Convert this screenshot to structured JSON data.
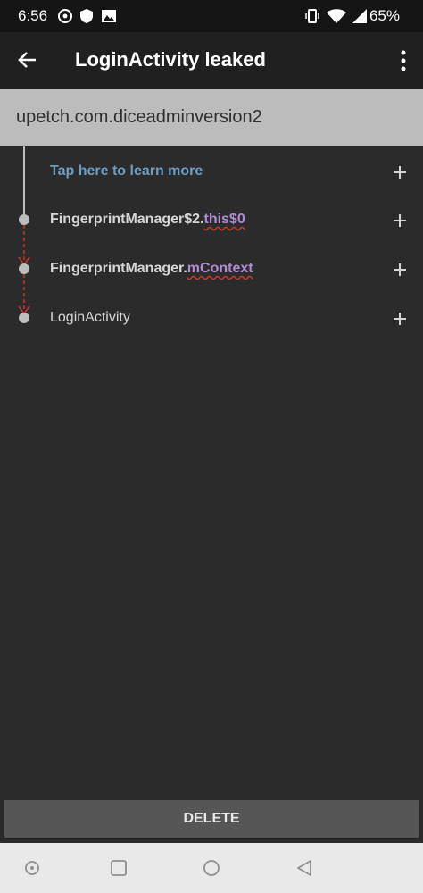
{
  "status": {
    "time": "6:56",
    "battery": "65%"
  },
  "toolbar": {
    "title": "LoginActivity leaked"
  },
  "header": {
    "package": "upetch.com.diceadminversion2"
  },
  "tree": {
    "learn_more": "Tap here to learn more",
    "rows": [
      {
        "prefix": "FingerprintManager$2.",
        "ref": "this$0"
      },
      {
        "prefix": "FingerprintManager.",
        "ref": "mContext"
      },
      {
        "prefix": "LoginActivity",
        "ref": ""
      }
    ]
  },
  "actions": {
    "delete_label": "DELETE"
  },
  "colors": {
    "link": "#6d9ec4",
    "reference": "#b18bd6",
    "leak_path": "#c0392b"
  }
}
